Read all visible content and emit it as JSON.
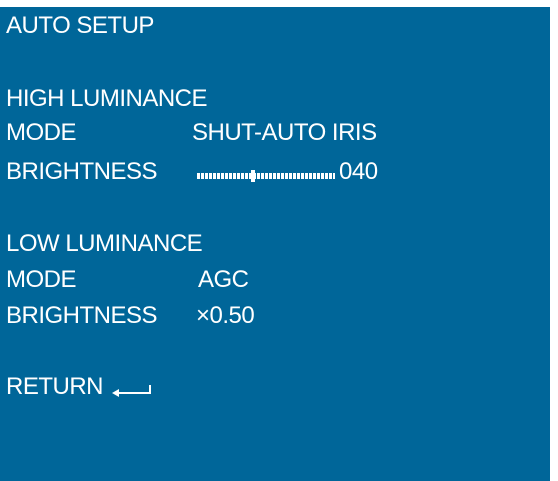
{
  "osd": {
    "title": "AUTO SETUP",
    "high": {
      "heading": "HIGH LUMINANCE",
      "mode_label": "MODE",
      "mode_value": "SHUT-AUTO IRIS",
      "brightness_label": "BRIGHTNESS",
      "brightness_value": "040",
      "brightness_level": 0.4
    },
    "low": {
      "heading": "LOW LUMINANCE",
      "mode_label": "MODE",
      "mode_value": "AGC",
      "brightness_label": "BRIGHTNESS",
      "brightness_value": "×0.50"
    },
    "return_label": "RETURN",
    "return_icon": "enter-arrow-icon",
    "colors": {
      "background": "#006699",
      "text": "#ffffff"
    }
  }
}
